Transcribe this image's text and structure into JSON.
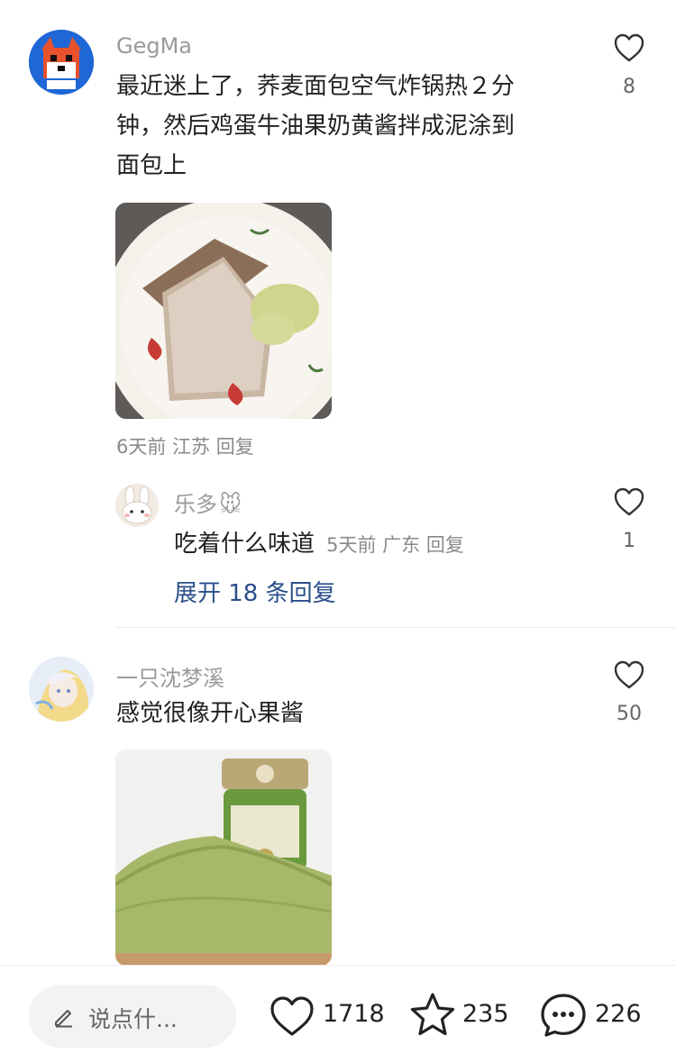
{
  "comments": [
    {
      "user": "GegMa",
      "text_lines": [
        "最近迷上了，荞麦面包空气炸锅热２分",
        "钟，然后鸡蛋牛油果奶黄酱拌成泥涂到",
        "面包上"
      ],
      "meta": "6天前 江苏 回复",
      "likes": "8"
    },
    {
      "user": "一只沈梦溪",
      "text": "感觉很像开心果酱",
      "likes": "50"
    }
  ],
  "reply": {
    "user": "乐多",
    "user_emoji": "🐭",
    "text": "吃着什么味道",
    "meta": "5天前 广东 回复",
    "likes": "1"
  },
  "expand_label": "展开 18 条回复",
  "bottom_bar": {
    "input_placeholder": "说点什...",
    "likes": "1718",
    "stars": "235",
    "comments": "226"
  },
  "icons": {
    "like": "heart-outline-icon",
    "star": "star-outline-icon",
    "comment": "speech-bubble-icon",
    "edit": "pencil-icon"
  }
}
